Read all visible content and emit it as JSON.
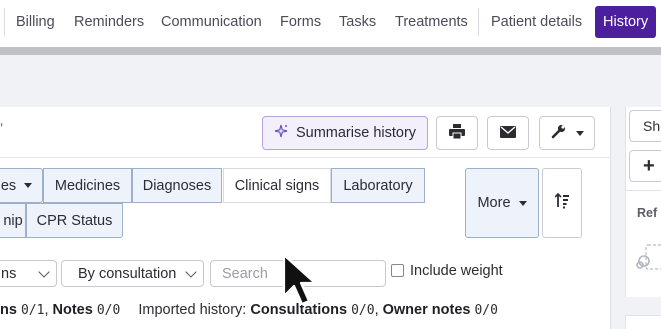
{
  "tabs": [
    {
      "label": "Billing"
    },
    {
      "label": "Reminders"
    },
    {
      "label": "Communication"
    },
    {
      "label": "Forms"
    },
    {
      "label": "Tasks"
    },
    {
      "label": "Treatments"
    },
    {
      "label": "Patient details"
    },
    {
      "label": "History",
      "active": true
    }
  ],
  "toolbar": {
    "summarise_label": "Summarise history"
  },
  "filters": {
    "chips_row1": [
      "es",
      "Medicines",
      "Diagnoses",
      "Clinical signs",
      "Laboratory"
    ],
    "chips_row2": [
      "nip",
      "CPR Status"
    ],
    "more_label": "More"
  },
  "options": {
    "type_select": "ns",
    "group_select": "By consultation",
    "search_placeholder": "Search",
    "include_weight_label": "Include weight"
  },
  "counts": {
    "part1_label": "ns",
    "part1_value": "0/1",
    "notes_label": "Notes",
    "notes_value": "0/0",
    "imported_label": "Imported history:",
    "consultations_label": "Consultations",
    "consultations_value": "0/0",
    "owner_notes_label": "Owner notes",
    "owner_notes_value": "0/0"
  },
  "side": {
    "show_label": "Sh",
    "add_label": "+",
    "ref_label": "Ref"
  }
}
